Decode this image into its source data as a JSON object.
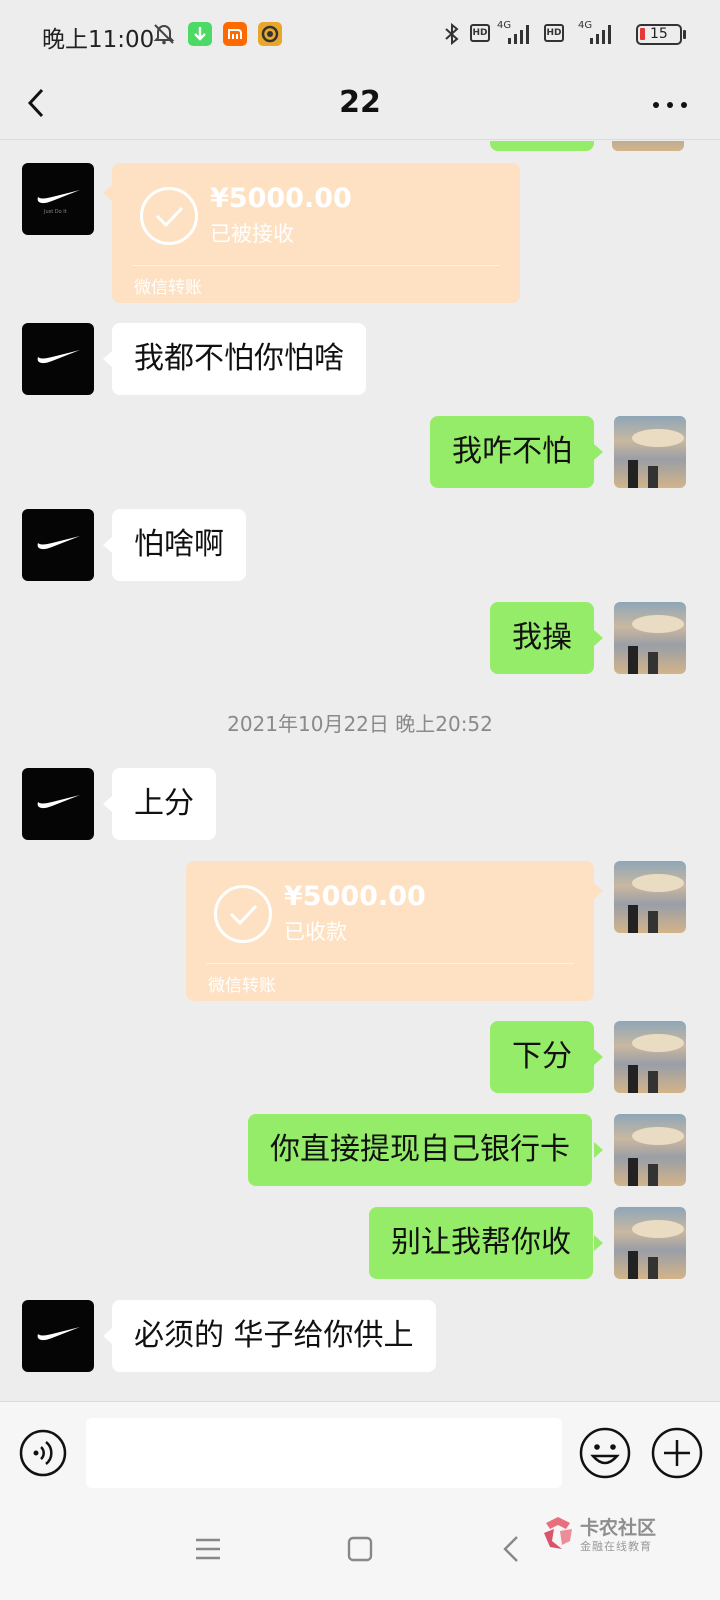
{
  "status_bar": {
    "time": "晚上11:00",
    "battery": "15",
    "network_labels": [
      "HD",
      "4G",
      "HD",
      "4G"
    ]
  },
  "header": {
    "title": "22"
  },
  "messages": {
    "m1": {
      "amount": "¥5000.00",
      "status": "已被接收",
      "label": "微信转账"
    },
    "m2": "我都不怕你怕啥",
    "m3": "我咋不怕",
    "m4": "怕啥啊",
    "m5": "我操",
    "timestamp": "2021年10月22日 晚上20:52",
    "m6": "上分",
    "m7": {
      "amount": "¥5000.00",
      "status": "已收款",
      "label": "微信转账"
    },
    "m8": "下分",
    "m9": "你直接提现自己银行卡",
    "m10": "别让我帮你收",
    "m11": "必须的 华子给你供上"
  },
  "avatar_text": "Just Do It",
  "input": {
    "placeholder": ""
  },
  "watermark": {
    "title": "卡农社区",
    "subtitle": "金融在线教育"
  },
  "icons": {
    "status": [
      "mute-bell-icon",
      "download-icon",
      "mi-icon",
      "app-icon",
      "bluetooth-icon",
      "signal-icon",
      "battery-icon"
    ],
    "header": [
      "back-arrow-icon",
      "more-dots-icon"
    ],
    "input": [
      "voice-icon",
      "emoji-icon",
      "plus-icon"
    ],
    "nav": [
      "menu-icon",
      "home-square-icon",
      "back-triangle-icon"
    ]
  },
  "colors": {
    "background": "#ededed",
    "bubble_out": "#95ec69",
    "bubble_in": "#ffffff",
    "transfer": "#fde1c2"
  }
}
